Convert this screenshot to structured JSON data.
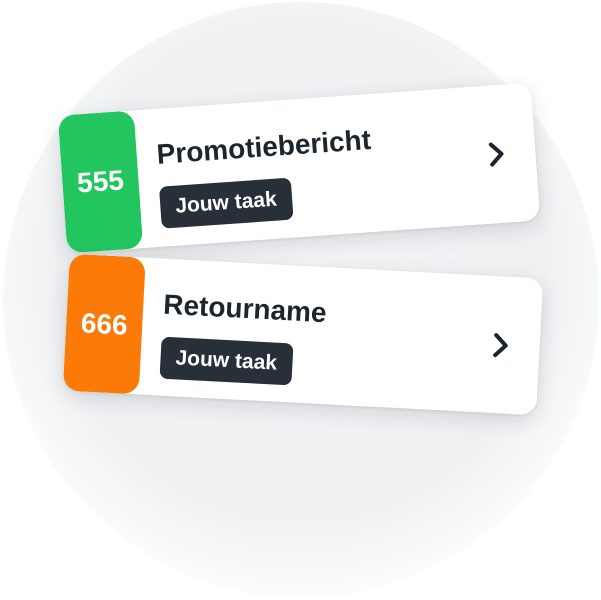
{
  "cards": [
    {
      "number": "555",
      "title": "Promotiebericht",
      "badge": "Jouw taak",
      "color": "#23c55e",
      "action_icon": "chevron-right-icon"
    },
    {
      "number": "666",
      "title": "Retourname",
      "badge": "Jouw taak",
      "color": "#fb7a08",
      "action_icon": "chevron-right-icon"
    }
  ],
  "colors": {
    "text": "#1d252c",
    "badge_bg": "#273038",
    "backdrop": "#f1f2f4"
  }
}
